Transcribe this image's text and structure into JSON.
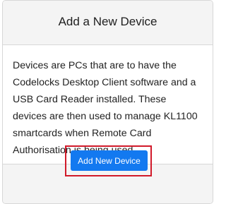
{
  "card": {
    "title": "Add a New Device",
    "description": "Devices are PCs that are to have the Codelocks Desktop Client software and a USB Card Reader installed. These devices are then used to manage KL1100 smartcards when Remote Card Authorisation is being used."
  },
  "footer": {
    "add_button_label": "Add New Device"
  },
  "colors": {
    "button_bg": "#1379f0",
    "highlight_border": "#d11a2a",
    "header_bg": "#f4f4f4"
  }
}
